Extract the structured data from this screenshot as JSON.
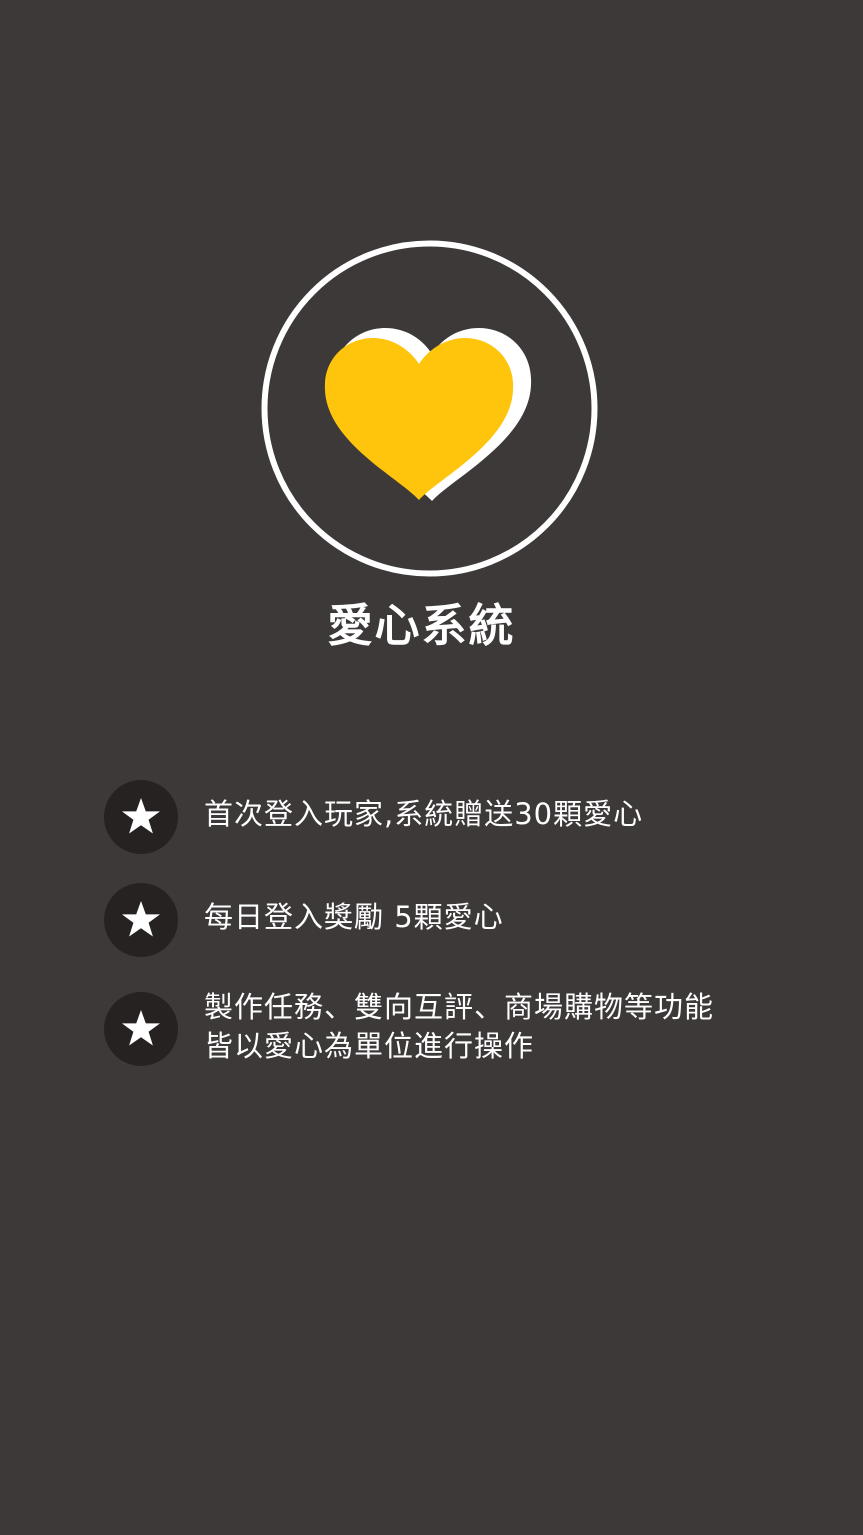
{
  "header": {
    "title": "愛心系統"
  },
  "hero": {
    "icon": "heart-icon",
    "heart_color": "#ffc40c",
    "ring_color": "#ffffff"
  },
  "rules": [
    {
      "icon": "star-icon",
      "lines": [
        "首次登入玩家,系統贈送30顆愛心"
      ]
    },
    {
      "icon": "star-icon",
      "lines": [
        "每日登入獎勵 5顆愛心"
      ]
    },
    {
      "icon": "star-icon",
      "lines": [
        "製作任務、雙向互評、商場購物等功能",
        "皆以愛心為單位進行操作"
      ]
    }
  ],
  "colors": {
    "background": "#3d3939",
    "bullet_background": "#272222",
    "text": "#ffffff"
  }
}
